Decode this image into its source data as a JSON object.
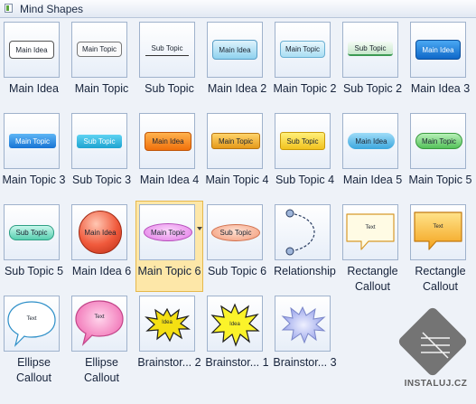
{
  "panel": {
    "title": "Mind Shapes"
  },
  "shapes": [
    {
      "label": "Main Idea",
      "text": "Main Idea"
    },
    {
      "label": "Main Topic",
      "text": "Main Topic"
    },
    {
      "label": "Sub Topic",
      "text": "Sub Topic"
    },
    {
      "label": "Main Idea 2",
      "text": "Main Idea"
    },
    {
      "label": "Main Topic 2",
      "text": "Main Topic"
    },
    {
      "label": "Sub Topic 2",
      "text": "Sub Topic"
    },
    {
      "label": "Main Idea 3",
      "text": "Main Idea"
    },
    {
      "label": "Main Topic 3",
      "text": "Main Topic"
    },
    {
      "label": "Sub Topic 3",
      "text": "Sub Topic"
    },
    {
      "label": "Main Idea 4",
      "text": "Main Idea"
    },
    {
      "label": "Main Topic 4",
      "text": "Main Topic"
    },
    {
      "label": "Sub Topic 4",
      "text": "Sub Topic"
    },
    {
      "label": "Main Idea 5",
      "text": "Main Idea"
    },
    {
      "label": "Main Topic 5",
      "text": "Main Topic"
    },
    {
      "label": "Sub Topic 5",
      "text": "Sub Topic"
    },
    {
      "label": "Main Idea 6",
      "text": "Main Idea"
    },
    {
      "label": "Main Topic 6",
      "text": "Main Topic"
    },
    {
      "label": "Sub Topic 6",
      "text": "Sub Topic"
    },
    {
      "label": "Relationship",
      "text": ""
    },
    {
      "label": "Rectangle Callout",
      "text": "Text"
    },
    {
      "label": "Rectangle Callout",
      "text": "Text"
    },
    {
      "label": "Ellipse Callout",
      "text": "Text"
    },
    {
      "label": "Ellipse Callout",
      "text": "Text"
    },
    {
      "label": "Brainstor... 2",
      "text": "Idea"
    },
    {
      "label": "Brainstor... 1",
      "text": "Idea"
    },
    {
      "label": "Brainstor... 3",
      "text": ""
    }
  ],
  "selected_index": 16,
  "watermark": {
    "text": "INSTALUJ.CZ"
  },
  "colors": {
    "selection": "#fde7a8",
    "panel_bg": "#eef2f8"
  }
}
